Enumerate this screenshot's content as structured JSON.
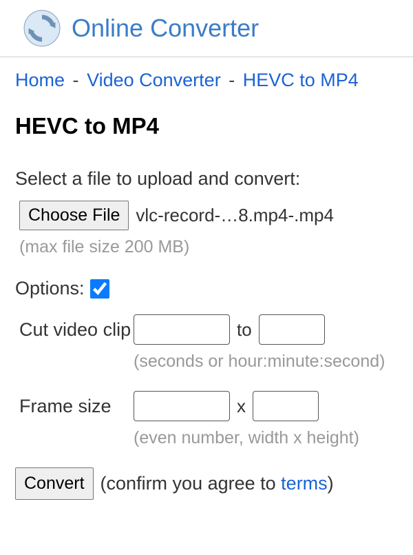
{
  "brand": "Online Converter",
  "breadcrumb": {
    "home": "Home",
    "sep": "-",
    "video_converter": "Video Converter",
    "current": "HEVC to MP4"
  },
  "page_title": "HEVC to MP4",
  "select_prompt": "Select a file to upload and convert:",
  "choose_file_label": "Choose File",
  "selected_filename": "vlc-record-…8.mp4-.mp4",
  "max_size_hint": "(max file size 200 MB)",
  "options_label": "Options:",
  "options_checked": true,
  "cut": {
    "label": "Cut video clip",
    "start": "",
    "to": "to",
    "end": "",
    "hint": "(seconds or hour:minute:second)"
  },
  "frame": {
    "label": "Frame size",
    "width": "",
    "x": "x",
    "height": "",
    "hint": "(even number, width x height)"
  },
  "convert_label": "Convert",
  "confirm_prefix": "(confirm you agree to ",
  "terms_label": "terms",
  "confirm_suffix": ")"
}
